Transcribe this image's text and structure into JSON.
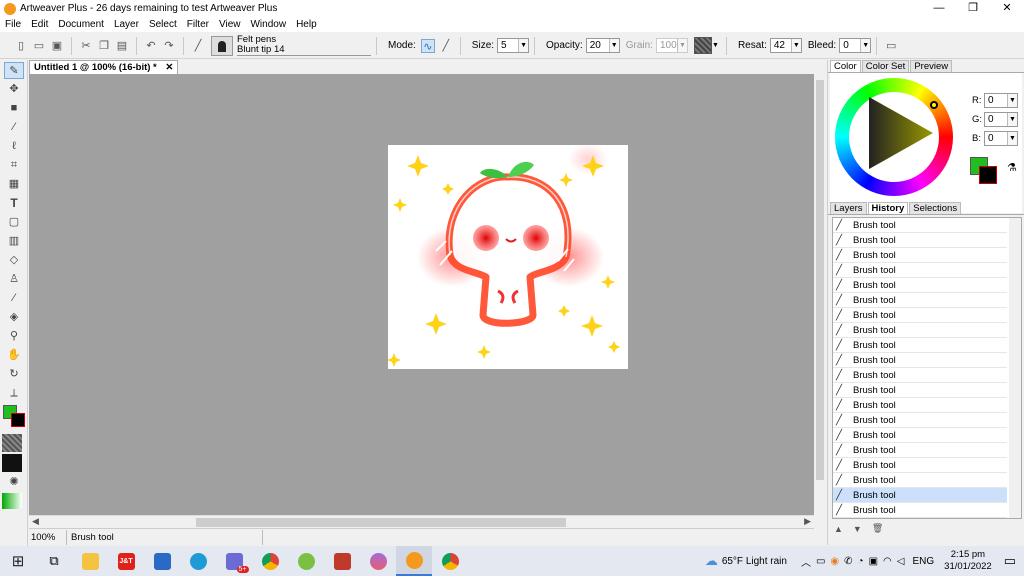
{
  "window": {
    "title": "Artweaver Plus - 26 days remaining to test Artweaver Plus",
    "min": "—",
    "max": "❐",
    "close": "✕"
  },
  "menu": [
    "File",
    "Edit",
    "Document",
    "Layer",
    "Select",
    "Filter",
    "View",
    "Window",
    "Help"
  ],
  "toolbar": {
    "brush_category": "Felt pens",
    "brush_name": "Blunt tip 14",
    "mode_label": "Mode:",
    "size_label": "Size:",
    "size_value": "5",
    "opacity_label": "Opacity:",
    "opacity_value": "20",
    "grain_label": "Grain:",
    "grain_value": "100",
    "resat_label": "Resat:",
    "resat_value": "42",
    "bleed_label": "Bleed:",
    "bleed_value": "0"
  },
  "document": {
    "tab_title": "Untitled 1 @ 100% (16-bit) *",
    "tab_close": "✕"
  },
  "status": {
    "zoom": "100%",
    "tool": "Brush tool"
  },
  "color_panel": {
    "tabs": [
      "Color",
      "Color Set",
      "Preview"
    ],
    "r_label": "R:",
    "r": "0",
    "g_label": "G:",
    "g": "0",
    "b_label": "B:",
    "b": "0",
    "foreground": "#1fbf1f",
    "background": "#000000"
  },
  "history_panel": {
    "tabs": [
      "Layers",
      "History",
      "Selections"
    ],
    "items": [
      "Brush tool",
      "Brush tool",
      "Brush tool",
      "Brush tool",
      "Brush tool",
      "Brush tool",
      "Brush tool",
      "Brush tool",
      "Brush tool",
      "Brush tool",
      "Brush tool",
      "Brush tool",
      "Brush tool",
      "Brush tool",
      "Brush tool",
      "Brush tool",
      "Brush tool",
      "Brush tool",
      "Brush tool",
      "Brush tool"
    ],
    "selected_index": 18
  },
  "taskbar": {
    "weather": "65°F  Light rain",
    "lang": "ENG",
    "time": "2:15 pm",
    "date": "31/01/2022",
    "jt_label": "J&T",
    "badge": "5+"
  }
}
